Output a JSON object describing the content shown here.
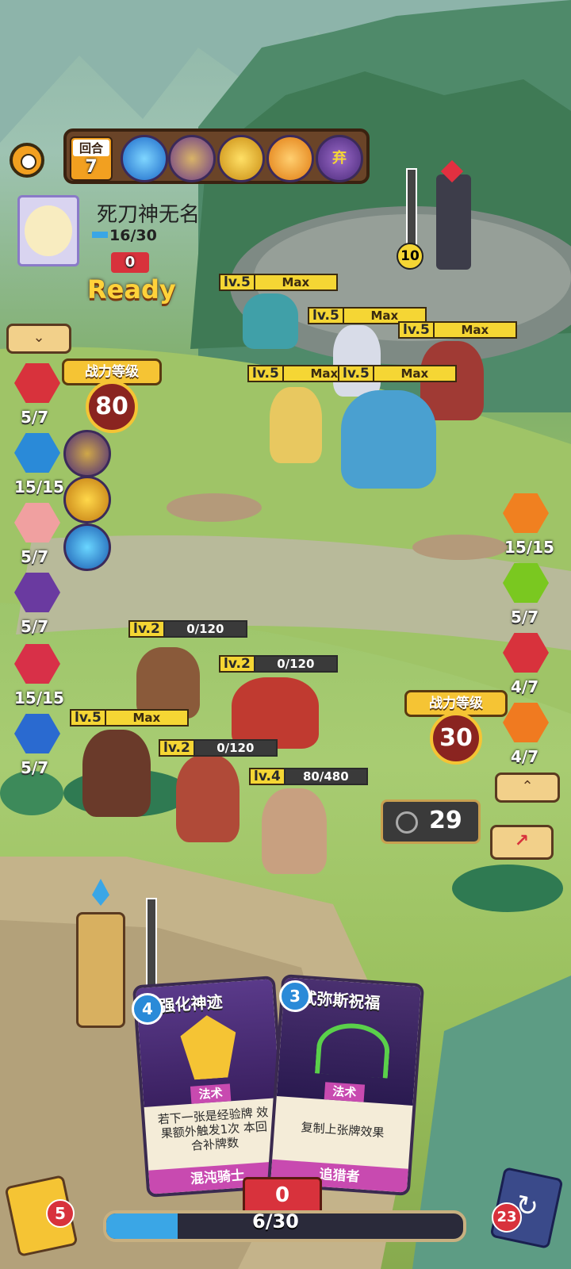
{
  "hud": {
    "round_label": "回合",
    "round_value": "7",
    "discard_label": "弃",
    "player_name": "死刀神无名",
    "player_hp": "16/30",
    "player_shield": "0",
    "ready_label": "Ready",
    "tower_value": "10"
  },
  "power": {
    "label": "战力等级",
    "enemy_value": "80",
    "player_label": "战力等级",
    "player_value": "30"
  },
  "left_stats": [
    "5/7",
    "15/15",
    "5/7",
    "5/7",
    "15/15",
    "5/7"
  ],
  "right_stats": [
    "15/15",
    "5/7",
    "4/7",
    "4/7"
  ],
  "enemy_tags": [
    {
      "lv": "lv.5",
      "text": "Max"
    },
    {
      "lv": "lv.5",
      "text": "Max"
    },
    {
      "lv": "lv.5",
      "text": "Max"
    },
    {
      "lv": "lv.5",
      "text": "Max"
    },
    {
      "lv": "lv.5",
      "text": "Max"
    }
  ],
  "ally_tags": [
    {
      "lv": "lv.2",
      "text": "0/120"
    },
    {
      "lv": "lv.2",
      "text": "0/120"
    },
    {
      "lv": "lv.5",
      "text": "Max"
    },
    {
      "lv": "lv.2",
      "text": "0/120"
    },
    {
      "lv": "lv.4",
      "text": "80/480"
    }
  ],
  "timer": "29",
  "cards": [
    {
      "cost": "4",
      "title": "强化神迹",
      "type": "法术",
      "desc": "若下一张是经验牌 效果额外触发1次 本回合补牌数",
      "class": "混沌骑士"
    },
    {
      "cost": "3",
      "title": "忒弥斯祝福",
      "type": "法术",
      "desc": "复制上张牌效果",
      "class": "追猎者"
    }
  ],
  "bottom": {
    "deck_count": "5",
    "discard_count": "23",
    "energy_value": "0",
    "mana": "6/30"
  },
  "colors": {
    "gold": "#f5d634",
    "panel": "#5a3a20",
    "red": "#d8323c",
    "blue": "#3aa6e6"
  }
}
